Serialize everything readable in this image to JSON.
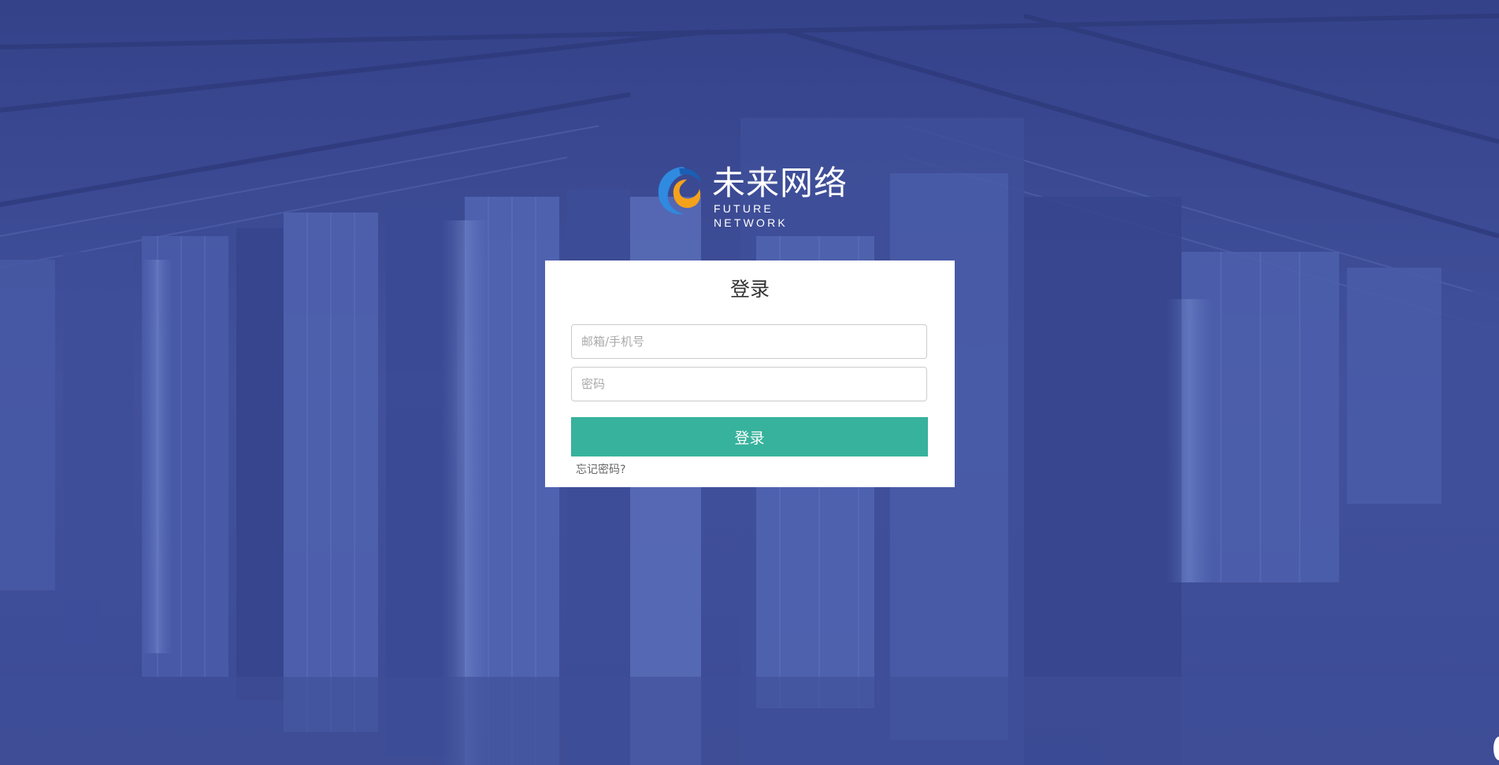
{
  "brand": {
    "name_cn": "未来网络",
    "name_en": "FUTURE NETWORK",
    "logo_icon": "swirl-logo-icon"
  },
  "login": {
    "title": "登录",
    "email_placeholder": "邮箱/手机号",
    "email_value": "",
    "password_placeholder": "密码",
    "password_value": "",
    "submit_label": "登录",
    "forgot_label": "忘记密码?"
  },
  "colors": {
    "background_overlay": "#3b4a93",
    "button": "#37b29c",
    "card": "#ffffff"
  }
}
